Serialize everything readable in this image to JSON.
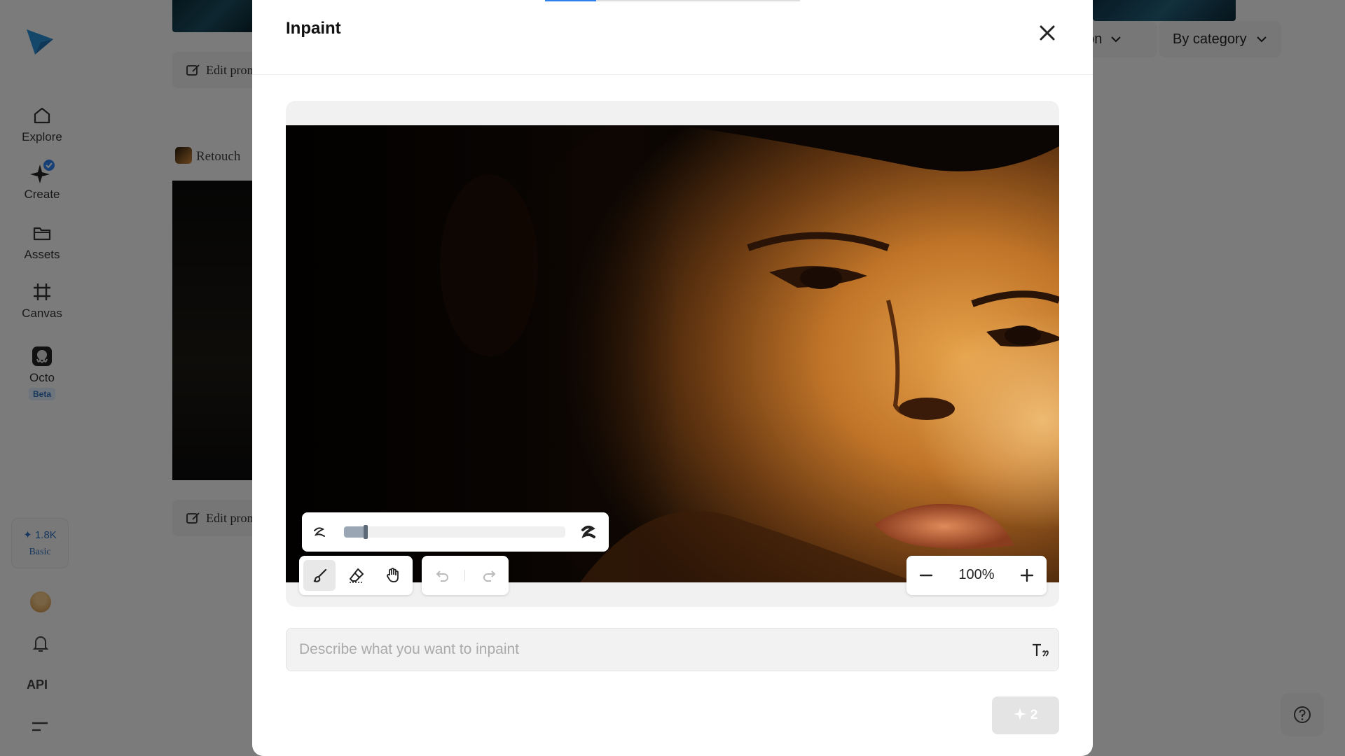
{
  "sidebar": {
    "items": [
      {
        "label": "Explore",
        "icon": "home-icon"
      },
      {
        "label": "Create",
        "icon": "create-sparkle-icon"
      },
      {
        "label": "Assets",
        "icon": "folder-icon"
      },
      {
        "label": "Canvas",
        "icon": "crop-frame-icon"
      },
      {
        "label": "Octo",
        "icon": "octo-app-icon",
        "badge": "Beta"
      }
    ],
    "credits": {
      "amount": "1.8K",
      "plan": "Basic"
    },
    "api_label": "API"
  },
  "background": {
    "edit_prompt_label": "Edit prom",
    "retouch_label": "Retouch",
    "filter_partial": "ation",
    "filter_category": "By category"
  },
  "modal": {
    "title": "Inpaint",
    "progress_fraction": 0.2,
    "brush_size_fraction": 0.1,
    "zoom": "100%",
    "prompt": {
      "value": "",
      "placeholder": "Describe what you want to inpaint"
    },
    "generate": {
      "cost": "2"
    }
  },
  "colors": {
    "accent": "#2f80ed",
    "badge_bg": "#dde9f7",
    "badge_text": "#2f6fbf"
  }
}
